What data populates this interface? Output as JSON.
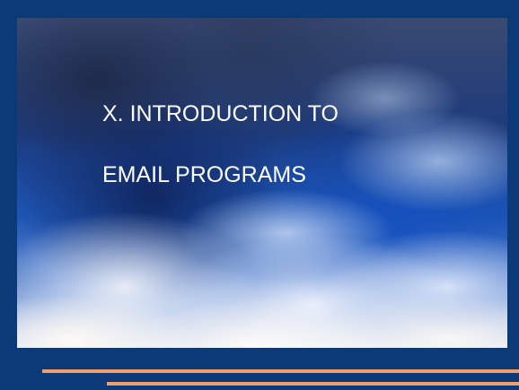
{
  "slide": {
    "title_line_1": "X. INTRODUCTION TO",
    "title_line_2": "EMAIL PROGRAMS"
  },
  "colors": {
    "background": "#0a3a78",
    "title_text": "#ffffff",
    "accent_lines": "#f0a06a"
  }
}
